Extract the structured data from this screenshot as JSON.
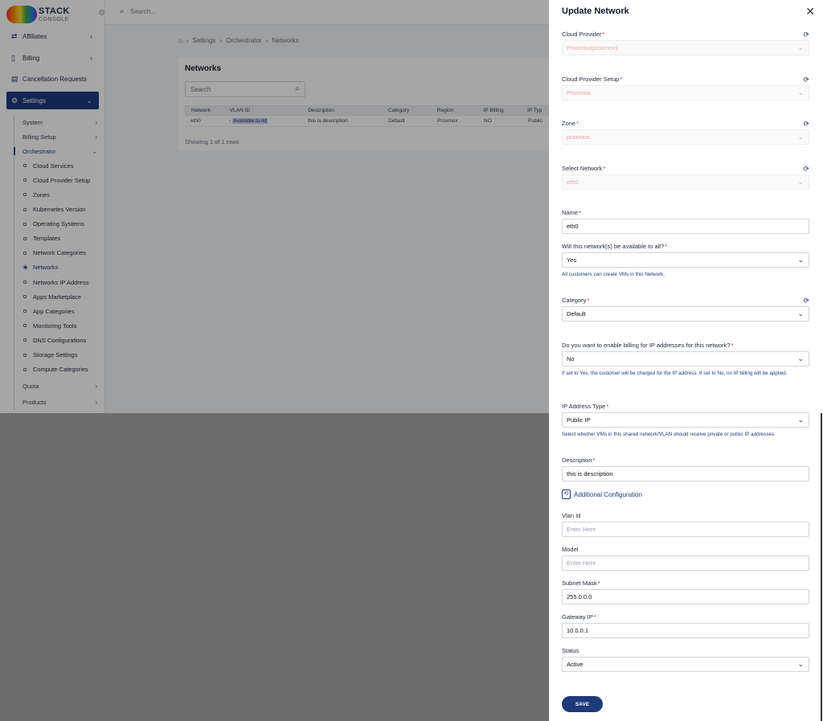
{
  "brand": {
    "line1": "STACK",
    "line2": "CONSOLE"
  },
  "sidebar": {
    "top_items": [
      {
        "label": "Affiliates",
        "icon": "affiliates-icon"
      },
      {
        "label": "Billing",
        "icon": "billing-icon"
      },
      {
        "label": "Cancellation Requests",
        "icon": "cancellation-icon"
      },
      {
        "label": "Settings",
        "icon": "settings-icon"
      }
    ],
    "sub_items": [
      "System",
      "Billing Setup",
      "Orchestrator"
    ],
    "children": [
      "Cloud Services",
      "Cloud Provider Setup",
      "Zones",
      "Kubernetes Version",
      "Operating Systems",
      "Templates",
      "Network Categories",
      "Networks",
      "Networks IP Address",
      "Apps Marketplace",
      "App Categories",
      "Monitoring Tools",
      "DNS Configurations",
      "Storage Settings",
      "Compute Categories"
    ],
    "after_items": [
      "Quota",
      "Products"
    ]
  },
  "topbar": {
    "search_placeholder": "Search..."
  },
  "breadcrumb": [
    "Settings",
    "Orchestrator",
    "Networks"
  ],
  "networks": {
    "title": "Networks",
    "search_placeholder": "Search",
    "columns": [
      "Network",
      "VLAN ID",
      "Description",
      "Category",
      "Region",
      "IP Billing",
      "IP Typ"
    ],
    "rows": [
      {
        "network": "eth0",
        "vlan_dash": "-",
        "vlan_badge": "Available to All",
        "description": "this is description",
        "category": "Default",
        "region": "Proxmox",
        "ip_billing": "NO",
        "ip_type": "Public"
      }
    ],
    "footer": "Showing 1 of 1 rows"
  },
  "drawer": {
    "title": "Update Network",
    "fields": {
      "cloud_provider": {
        "label": "Cloud Provider",
        "value": "Proxmox(proxmox)"
      },
      "cloud_provider_setup": {
        "label": "Cloud Provider Setup",
        "value": "Proxmox"
      },
      "zone": {
        "label": "Zone",
        "value": "proxmox"
      },
      "select_network": {
        "label": "Select Network",
        "value": "eth0"
      },
      "name": {
        "label": "Name",
        "value": "eth0"
      },
      "available_all": {
        "label": "Will this network(s) be available to all?",
        "value": "Yes",
        "help": "All customers can create VMs in this Network."
      },
      "category": {
        "label": "Category",
        "value": "Default"
      },
      "ip_billing": {
        "label": "Do you want to enable billing for IP addresses for this network?",
        "value": "No",
        "help": "If set to Yes, the customer will be charged for the IP address. If set to No, no IP billing will be applied."
      },
      "ip_type": {
        "label": "IP Address Type",
        "value": "Public IP",
        "help": "Select whether VMs in this shared network/VLAN should receive private or public IP addresses."
      },
      "description": {
        "label": "Description",
        "value": "this is description"
      },
      "vlan_id": {
        "label": "Vlan Id",
        "placeholder": "Enter Here"
      },
      "model": {
        "label": "Model",
        "placeholder": "Enter Here"
      },
      "subnet_mask": {
        "label": "Subnet Mask",
        "value": "255.0.0.0"
      },
      "gateway_ip": {
        "label": "Gateway IP",
        "value": "10.0.0.1"
      },
      "status": {
        "label": "Status",
        "value": "Active"
      }
    },
    "additional_config": "Additional Configuration",
    "save_label": "SAVE"
  },
  "colors": {
    "primary": "#1e3a7b",
    "required": "#dc2626"
  }
}
